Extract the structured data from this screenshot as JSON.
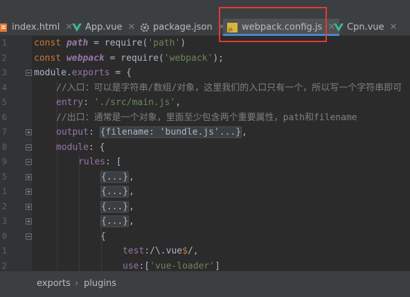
{
  "tabs": [
    {
      "label": "index.html",
      "icon": "html-file-icon"
    },
    {
      "label": "App.vue",
      "icon": "vue-file-icon"
    },
    {
      "label": "package.json",
      "icon": "json-file-icon"
    },
    {
      "label": "webpack.config.js",
      "icon": "js-file-icon",
      "active": true
    },
    {
      "label": "Cpn.vue",
      "icon": "vue-file-icon"
    }
  ],
  "code": {
    "line_numbers": [
      "1",
      "2",
      "3",
      "4",
      "5",
      "6",
      "7",
      "8",
      "9",
      "5",
      "1",
      "2",
      "3",
      "0",
      "1",
      "2",
      "3"
    ],
    "l1": {
      "kw": "const",
      "var": "path",
      "op": " = require(",
      "str": "'path'",
      "end": ")"
    },
    "l2": {
      "kw": "const",
      "var": "webpack",
      "op": " = require(",
      "str": "'webpack'",
      "end": ");"
    },
    "l3": {
      "text": "module.",
      "prop": "exports",
      "end": " = {"
    },
    "l4": {
      "comment": "//入口：可以是字符串/数组/对象，这里我们的入口只有一个，所以写一个字符串即可"
    },
    "l5": {
      "key": "entry",
      "colon": ": ",
      "str": "'./src/main.js'",
      "end": ","
    },
    "l6": {
      "comment": "//出口：通常是一个对象，里面至少包含两个重要属性，path和filename"
    },
    "l7": {
      "key": "output",
      "colon": ": ",
      "folded": "{filename: 'bundle.js'...}",
      "end": ","
    },
    "l8": {
      "key": "module",
      "end": ": {"
    },
    "l9": {
      "key": "rules",
      "end": ": ["
    },
    "l10": {
      "folded": "{...}",
      "end": ","
    },
    "l11": {
      "folded": "{...}",
      "end": ","
    },
    "l12": {
      "folded": "{...}",
      "end": ","
    },
    "l13": {
      "folded": "{...}",
      "end": ","
    },
    "l14": {
      "text": "{"
    },
    "l15": {
      "key": "test",
      "colon": ":",
      "rx1": "/\\.vue",
      "rx2": "$",
      "rx3": "/",
      "end": ","
    },
    "l16": {
      "key": "use",
      "colon": ":[",
      "str": "'vue-loader'",
      "end": "]"
    }
  },
  "breadcrumb": {
    "item1": "exports",
    "sep": "›",
    "item2": "plugins"
  },
  "colors": {
    "highlight_box": "#e53935",
    "keyword": "#cc7832",
    "string": "#6a8759",
    "comment": "#808080",
    "property": "#9876aa"
  }
}
